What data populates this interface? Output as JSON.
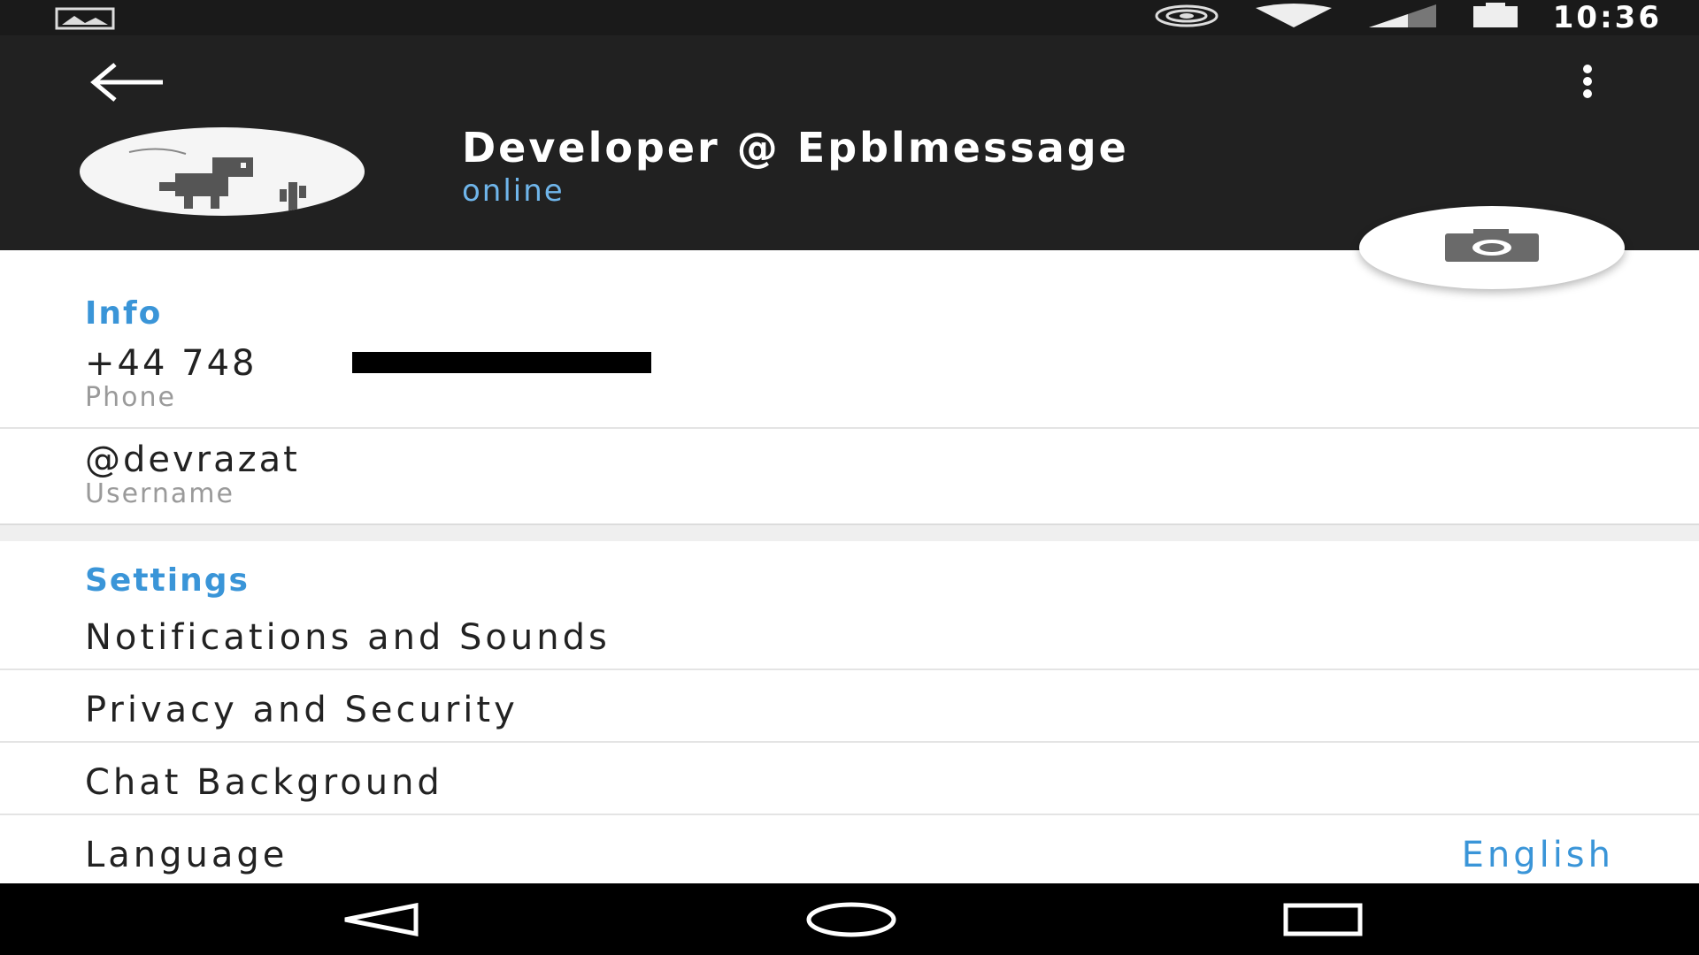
{
  "status_bar": {
    "time": "10:36"
  },
  "profile": {
    "name": "Developer @ Epblmessage",
    "status": "online"
  },
  "info": {
    "title": "Info",
    "phone_value": "+44 748",
    "phone_label": "Phone",
    "username_value": "@devrazat",
    "username_label": "Username"
  },
  "settings": {
    "title": "Settings",
    "items": [
      {
        "label": "Notifications and Sounds"
      },
      {
        "label": "Privacy and Security"
      },
      {
        "label": "Chat Background"
      },
      {
        "label": "Language",
        "value": "English"
      }
    ]
  },
  "colors": {
    "accent": "#3a95d8",
    "header_bg": "#212121",
    "online": "#6fb5ea"
  }
}
